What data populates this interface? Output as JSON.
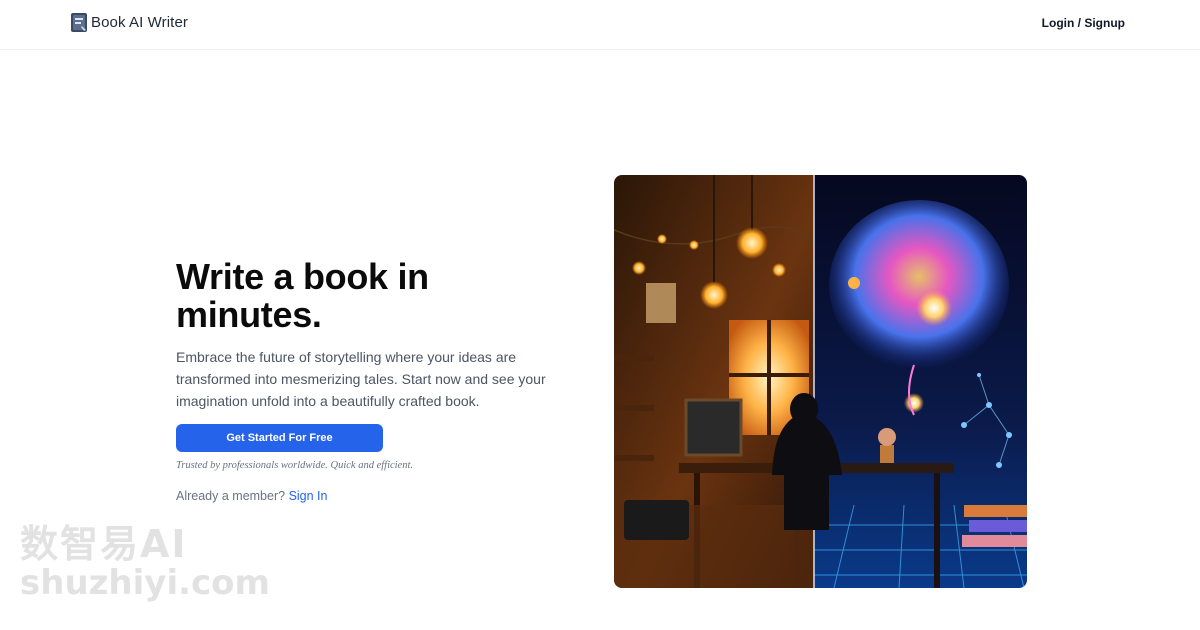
{
  "header": {
    "brand_name": "Book AI Writer",
    "brand_icon": "book-logo-icon",
    "auth_link": "Login / Signup"
  },
  "hero": {
    "title": "Write a book in minutes.",
    "description": "Embrace the future of storytelling where your ideas are transformed into mesmerizing tales. Start now and see your imagination unfold into a beautifully crafted book.",
    "cta_label": "Get Started For Free",
    "trust_text": "Trusted by professionals worldwide. Quick and efficient.",
    "member_prompt": "Already a member?",
    "sign_in_label": "Sign In"
  },
  "watermark": {
    "line1": "数智易AI",
    "line2": "shuzhiyi.com"
  },
  "colors": {
    "accent": "#2563eb",
    "text": "#111827",
    "muted": "#6b7280"
  }
}
